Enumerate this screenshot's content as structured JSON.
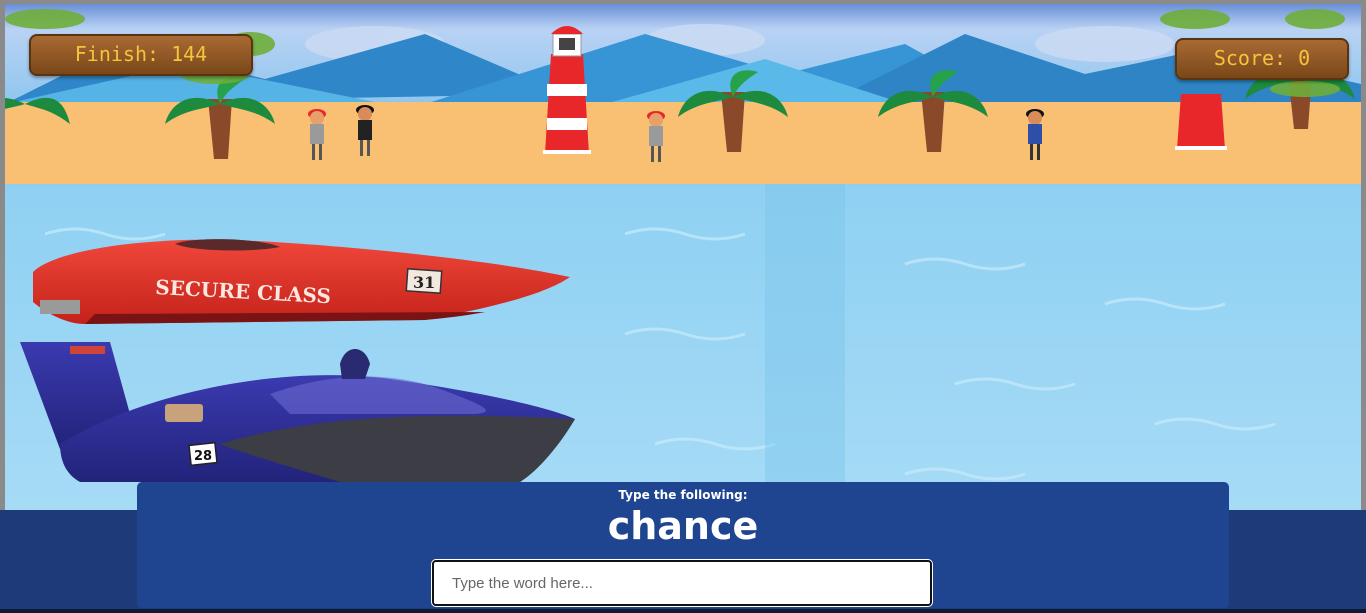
{
  "hud": {
    "finish_text": "Finish: 144",
    "score_text": "Score: 0"
  },
  "boats": {
    "red_boat": {
      "name_text": "SECURE CLASS",
      "number": "31"
    },
    "blue_boat": {
      "number": "28"
    }
  },
  "typing": {
    "instruction": "Type the following:",
    "word": "chance",
    "input_placeholder": "Type the word here...",
    "input_value": ""
  },
  "colors": {
    "sky": "#9fc7ee",
    "mountain": "#3a8fd0",
    "sand": "#f9c074",
    "water": "#9fd7f3",
    "red_boat": "#e8382b",
    "blue_boat": "#2d2f93",
    "panel": "#1f4590",
    "page": "#1f3a78",
    "hud_text": "#f4c43c"
  }
}
